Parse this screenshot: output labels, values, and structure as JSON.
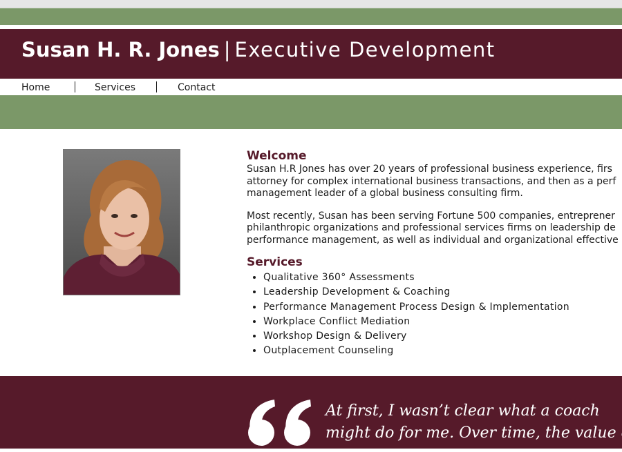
{
  "header": {
    "name": "Susan H. R. Jones",
    "separator": "|",
    "tagline": "Executive Development"
  },
  "nav": {
    "items": [
      {
        "label": "Home"
      },
      {
        "label": "Services"
      },
      {
        "label": "Contact"
      }
    ]
  },
  "welcome": {
    "heading": "Welcome",
    "paragraph1_lines": [
      "Susan H.R Jones has over 20 years of professional business experience, firs",
      "attorney for complex international business transactions, and then as a perf",
      "management leader of a global business consulting firm."
    ],
    "paragraph2_lines": [
      "Most recently, Susan has been serving Fortune 500 companies, entreprener",
      "philanthropic organizations and professional services firms on leadership de",
      "performance management, as well as individual and organizational effective"
    ]
  },
  "services": {
    "heading": "Services",
    "items": [
      "Qualitative 360° Assessments",
      "Leadership Development & Coaching",
      "Performance Management Process Design & Implementation",
      "Workplace Conflict Mediation",
      "Workshop Design & Delivery",
      "Outplacement Counseling"
    ]
  },
  "testimonial": {
    "lines": [
      "At first, I wasn’t clear what a coach",
      "might do for me. Over time, the value of"
    ]
  },
  "colors": {
    "maroon": "#561a2a",
    "green": "#7b9868"
  }
}
